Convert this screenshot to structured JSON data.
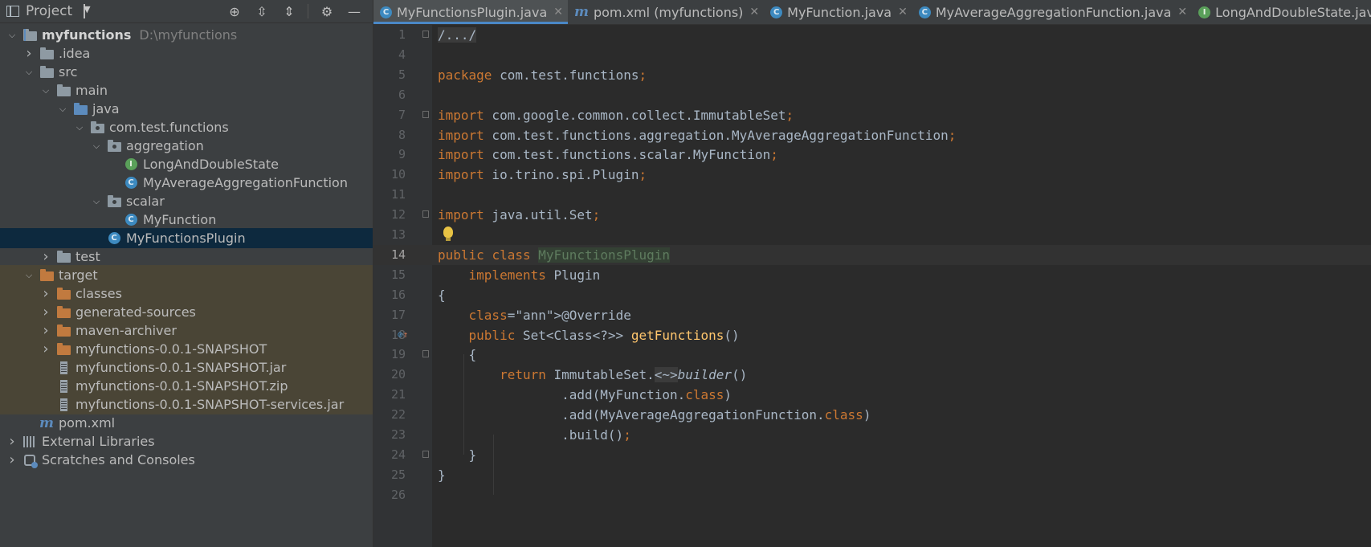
{
  "window": {
    "project_label": "Project"
  },
  "project_tree": [
    {
      "indent": 0,
      "arrow": "down",
      "icon": "module-folder-icon",
      "label": "myfunctions",
      "hint": "D:\\myfunctions",
      "bold": true
    },
    {
      "indent": 1,
      "arrow": "right",
      "icon": "folder-icon",
      "label": ".idea"
    },
    {
      "indent": 1,
      "arrow": "down",
      "icon": "folder-icon",
      "label": "src"
    },
    {
      "indent": 2,
      "arrow": "down",
      "icon": "folder-icon",
      "label": "main"
    },
    {
      "indent": 3,
      "arrow": "down",
      "icon": "source-folder-icon",
      "label": "java"
    },
    {
      "indent": 4,
      "arrow": "down",
      "icon": "package-icon",
      "label": "com.test.functions"
    },
    {
      "indent": 5,
      "arrow": "down",
      "icon": "package-icon",
      "label": "aggregation"
    },
    {
      "indent": 6,
      "arrow": "none",
      "icon": "interface-icon",
      "label": "LongAndDoubleState"
    },
    {
      "indent": 6,
      "arrow": "none",
      "icon": "class-icon",
      "label": "MyAverageAggregationFunction"
    },
    {
      "indent": 5,
      "arrow": "down",
      "icon": "package-icon",
      "label": "scalar"
    },
    {
      "indent": 6,
      "arrow": "none",
      "icon": "class-icon",
      "label": "MyFunction"
    },
    {
      "indent": 5,
      "arrow": "none",
      "icon": "class-icon",
      "label": "MyFunctionsPlugin",
      "selected": true
    },
    {
      "indent": 2,
      "arrow": "right",
      "icon": "folder-icon",
      "label": "test"
    },
    {
      "indent": 1,
      "arrow": "down",
      "icon": "excluded-folder-icon",
      "label": "target",
      "excluded": true
    },
    {
      "indent": 2,
      "arrow": "right",
      "icon": "excluded-folder-icon",
      "label": "classes",
      "excluded": true
    },
    {
      "indent": 2,
      "arrow": "right",
      "icon": "excluded-folder-icon",
      "label": "generated-sources",
      "excluded": true
    },
    {
      "indent": 2,
      "arrow": "right",
      "icon": "excluded-folder-icon",
      "label": "maven-archiver",
      "excluded": true
    },
    {
      "indent": 2,
      "arrow": "right",
      "icon": "excluded-folder-icon",
      "label": "myfunctions-0.0.1-SNAPSHOT",
      "excluded": true
    },
    {
      "indent": 2,
      "arrow": "none",
      "icon": "jar-icon",
      "label": "myfunctions-0.0.1-SNAPSHOT.jar",
      "excluded": true
    },
    {
      "indent": 2,
      "arrow": "none",
      "icon": "jar-icon",
      "label": "myfunctions-0.0.1-SNAPSHOT.zip",
      "excluded": true
    },
    {
      "indent": 2,
      "arrow": "none",
      "icon": "jar-icon",
      "label": "myfunctions-0.0.1-SNAPSHOT-services.jar",
      "excluded": true
    },
    {
      "indent": 1,
      "arrow": "none",
      "icon": "maven-icon",
      "label": "pom.xml"
    },
    {
      "indent": 0,
      "arrow": "right",
      "icon": "libraries-icon",
      "label": "External Libraries"
    },
    {
      "indent": 0,
      "arrow": "right",
      "icon": "scratches-icon",
      "label": "Scratches and Consoles"
    }
  ],
  "tabs": [
    {
      "icon": "class-icon",
      "label": "MyFunctionsPlugin.java",
      "active": true
    },
    {
      "icon": "maven-icon",
      "label": "pom.xml (myfunctions)"
    },
    {
      "icon": "class-icon",
      "label": "MyFunction.java"
    },
    {
      "icon": "class-icon",
      "label": "MyAverageAggregationFunction.java"
    },
    {
      "icon": "interface-icon",
      "label": "LongAndDoubleState.java"
    }
  ],
  "editor": {
    "current_line": 14,
    "lines": [
      {
        "n": "1",
        "code": "/.../"
      },
      {
        "n": "4",
        "code": ""
      },
      {
        "n": "5",
        "code": "package com.test.functions;"
      },
      {
        "n": "6",
        "code": ""
      },
      {
        "n": "7",
        "code": "import com.google.common.collect.ImmutableSet;"
      },
      {
        "n": "8",
        "code": "import com.test.functions.aggregation.MyAverageAggregationFunction;"
      },
      {
        "n": "9",
        "code": "import com.test.functions.scalar.MyFunction;"
      },
      {
        "n": "10",
        "code": "import io.trino.spi.Plugin;"
      },
      {
        "n": "11",
        "code": ""
      },
      {
        "n": "12",
        "code": "import java.util.Set;"
      },
      {
        "n": "13",
        "code": ""
      },
      {
        "n": "14",
        "code": "public class MyFunctionsPlugin"
      },
      {
        "n": "15",
        "code": "    implements Plugin"
      },
      {
        "n": "16",
        "code": "{"
      },
      {
        "n": "17",
        "code": "    @Override"
      },
      {
        "n": "18",
        "code": "    public Set<Class<?>> getFunctions()"
      },
      {
        "n": "19",
        "code": "    {"
      },
      {
        "n": "20",
        "code": "        return ImmutableSet.<~>builder()"
      },
      {
        "n": "21",
        "code": "                .add(MyFunction.class)"
      },
      {
        "n": "22",
        "code": "                .add(MyAverageAggregationFunction.class)"
      },
      {
        "n": "23",
        "code": "                .build();"
      },
      {
        "n": "24",
        "code": "    }"
      },
      {
        "n": "25",
        "code": "}"
      },
      {
        "n": "26",
        "code": ""
      }
    ]
  }
}
